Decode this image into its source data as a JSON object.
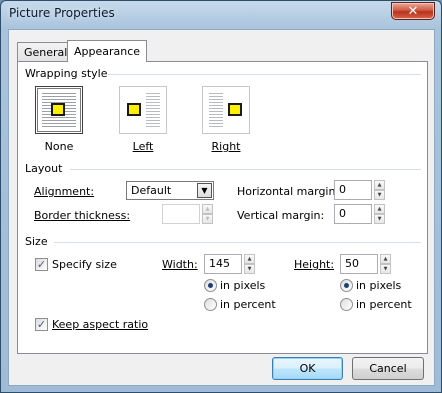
{
  "window": {
    "title": "Picture Properties",
    "close_icon": "close-icon"
  },
  "tabs": [
    {
      "label": "General",
      "active": false
    },
    {
      "label": "Appearance",
      "active": true
    }
  ],
  "wrapping": {
    "section_label": "Wrapping style",
    "options": [
      {
        "label": "None",
        "icon": "wrap-none-icon",
        "selected": true
      },
      {
        "label": "Left",
        "icon": "wrap-left-icon",
        "selected": false
      },
      {
        "label": "Right",
        "icon": "wrap-right-icon",
        "selected": false
      }
    ]
  },
  "layout": {
    "section_label": "Layout",
    "alignment_label": "Alignment:",
    "alignment_value": "Default",
    "border_label": "Border thickness:",
    "border_value": "",
    "hmargin_label": "Horizontal margin:",
    "hmargin_value": "0",
    "vmargin_label": "Vertical margin:",
    "vmargin_value": "0"
  },
  "size": {
    "section_label": "Size",
    "specify_label": "Specify size",
    "specify_checked": true,
    "width_label": "Width:",
    "width_value": "145",
    "height_label": "Height:",
    "height_value": "50",
    "in_pixels": "in pixels",
    "in_percent": "in percent",
    "keep_aspect_label": "Keep aspect ratio",
    "keep_aspect_checked": true
  },
  "buttons": {
    "ok": "OK",
    "cancel": "Cancel"
  }
}
